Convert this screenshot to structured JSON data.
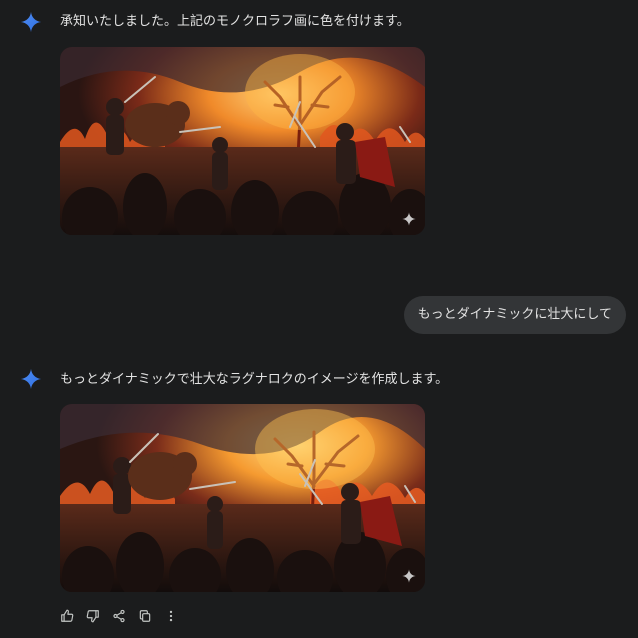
{
  "conversation": {
    "first_reply": {
      "text": "承知いたしました。上記のモノクロラフ画に色を付けます。",
      "image_label": "Generated image"
    },
    "user_message": {
      "text": "もっとダイナミックに壮大にして"
    },
    "second_reply": {
      "text": "もっとダイナミックで壮大なラグナロクのイメージを作成します。",
      "image_label": "Generated image"
    }
  },
  "actions": {
    "icons": [
      "thumbs-up-icon",
      "thumbs-down-icon",
      "share-icon",
      "copy-icon",
      "more-vert-icon"
    ]
  },
  "colors": {
    "background": "#1b1c1d",
    "user_bubble": "#333537",
    "text": "#e3e3e3",
    "gemini_blue": "#4285f4",
    "action_icon": "#c4c7c5"
  }
}
